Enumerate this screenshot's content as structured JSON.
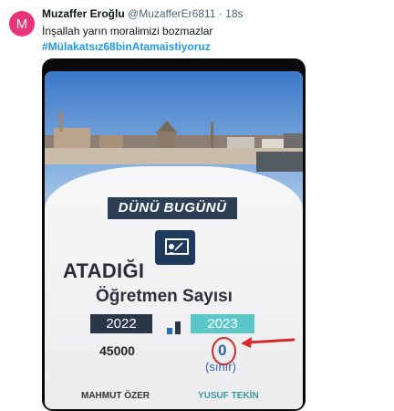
{
  "tweet": {
    "avatar_letter": "M",
    "display_name": "Muzaffer Eroğlu",
    "handle": "@MuzafferEr6811",
    "separator": "·",
    "time": "18s",
    "text": "İnşallah yarın moralimizi bozmazlar",
    "hashtag": "#Mülakatsız68binAtamaistiyoruz"
  },
  "image": {
    "banner": "DÜNÜ BUGÜNÜ",
    "heading_line1": "ATADIĞI",
    "heading_line2": "Öğretmen Sayısı",
    "year_left": "2022",
    "year_right": "2023",
    "value_left": "45000",
    "value_right": "0",
    "value_right_note": "(sınır)",
    "person_left": "MAHMUT ÖZER",
    "person_right": "YUSUF TEKİN"
  },
  "colors": {
    "avatar_bg": "#e7347a",
    "hashtag": "#1d9bf0",
    "banner_bg": "#2d3f54",
    "year_right_bg": "#5cc7c8",
    "annotation": "#d62b2b"
  },
  "icons": [
    "teacher-board-icon",
    "bar-chart-icon",
    "arrow-annotation-icon"
  ]
}
